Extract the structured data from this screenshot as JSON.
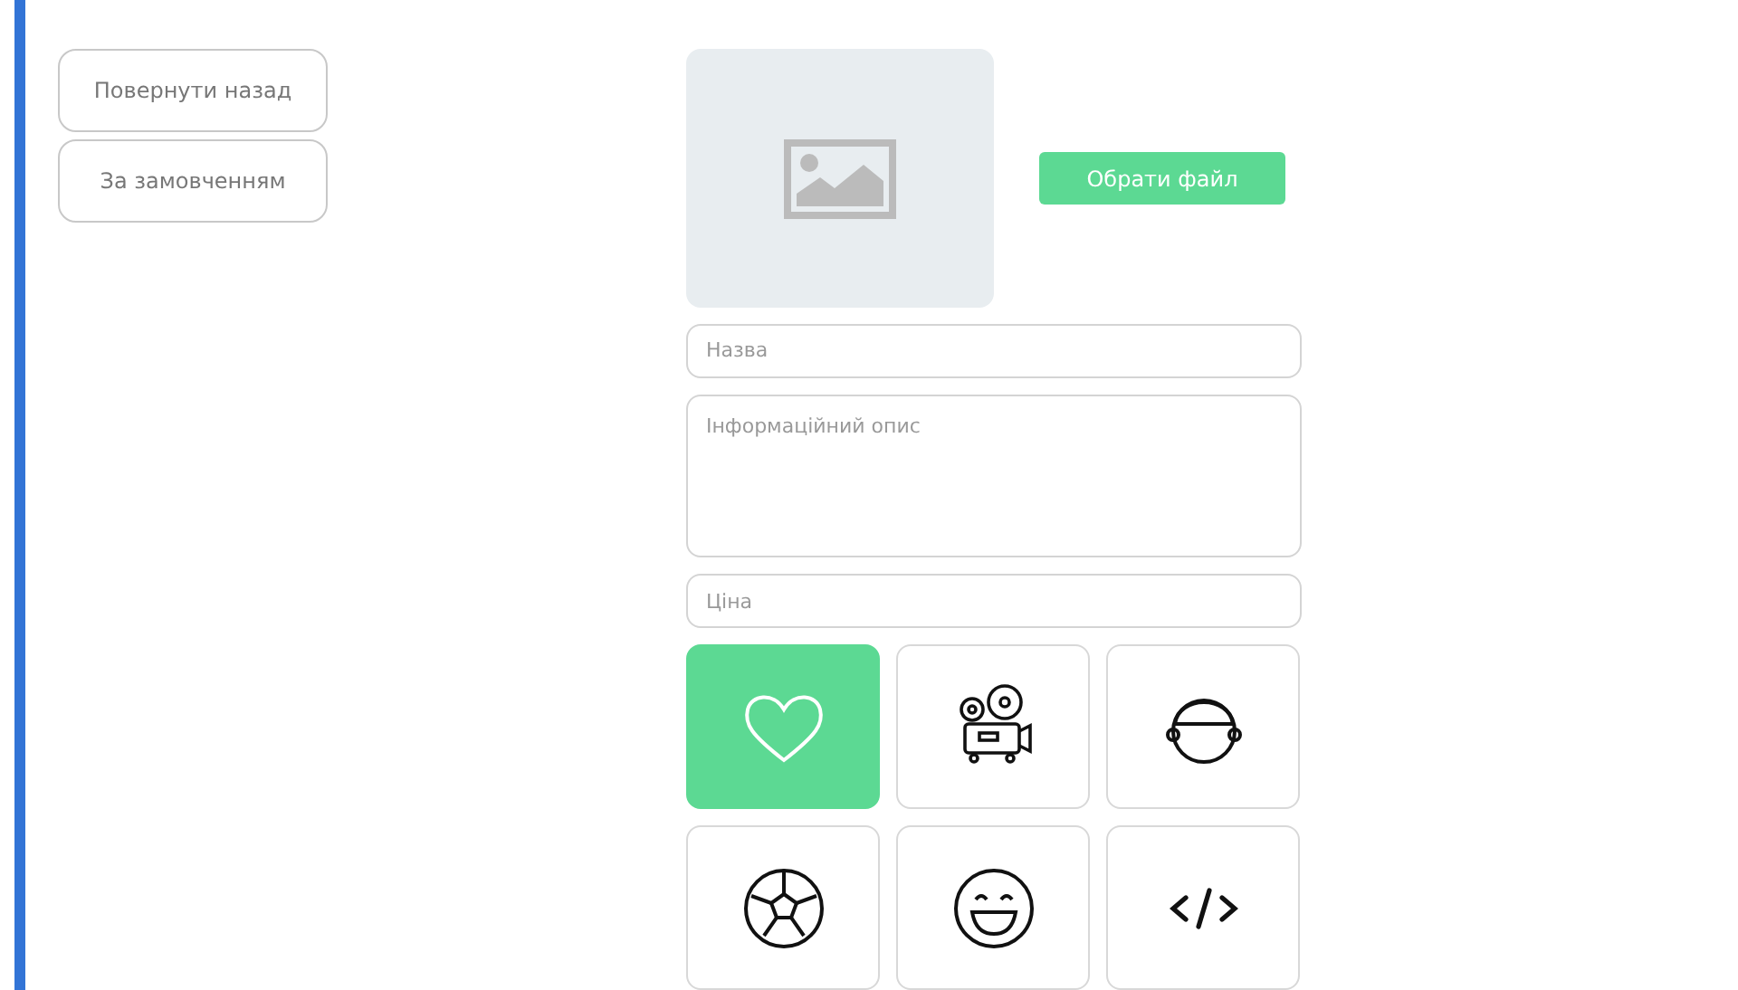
{
  "nav_buttons": [
    {
      "label": "Повернути назад"
    },
    {
      "label": "За замовченням"
    }
  ],
  "image_upload": {
    "button": "Обрати файл"
  },
  "fields": [
    {
      "kind": "input",
      "placeholder": "Назва"
    },
    {
      "kind": "textarea",
      "placeholder": "Інформаційний опис"
    },
    {
      "kind": "input",
      "placeholder": "Ціна"
    }
  ],
  "icon_tiles": [
    {
      "kind": "heart",
      "selected": true
    },
    {
      "kind": "projector",
      "selected": false
    },
    {
      "kind": "character",
      "selected": false
    },
    {
      "kind": "ball",
      "selected": false
    },
    {
      "kind": "smile",
      "selected": false
    },
    {
      "kind": "code",
      "selected": false
    }
  ]
}
